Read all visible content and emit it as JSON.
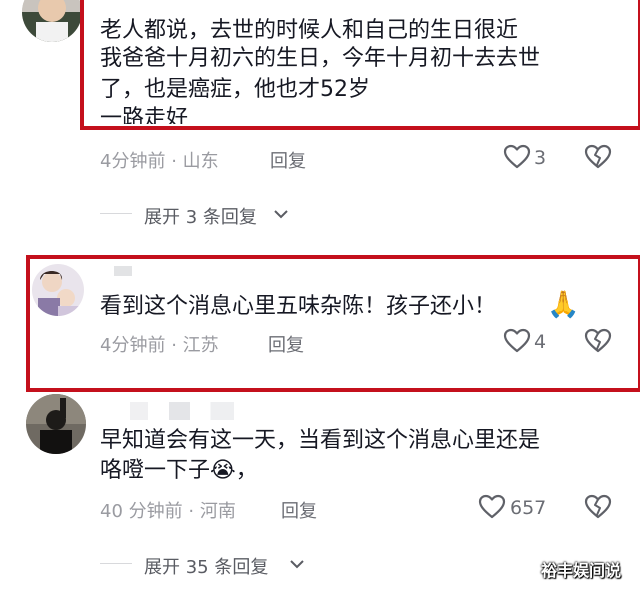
{
  "comments": [
    {
      "lines": [
        "老人都说，去世的时候人和自己的生日很近",
        "  我爸爸十月初六的生日，今年十月初十去去世",
        "了，也是癌症，他也才52岁",
        "一路走好"
      ],
      "time": "4分钟前",
      "location": "山东",
      "reply_label": "回复",
      "likes": "3",
      "expand_label": "展开 3 条回复"
    },
    {
      "lines": [
        "看到这个消息心里五味杂陈！孩子还小！"
      ],
      "emoji": "🙏",
      "time": "4分钟前",
      "location": "江苏",
      "reply_label": "回复",
      "likes": "4"
    },
    {
      "lines": [
        "早知道会有这一天，当看到这个消息心里还是",
        "咯噔一下子"
      ],
      "emoji": "😭",
      "time": "40 分钟前",
      "location": "河南",
      "reply_label": "回复",
      "likes": "657",
      "expand_label": "展开 35 条回复"
    }
  ],
  "meta_separator": "·",
  "watermark": "裕丰娱间说",
  "colors": {
    "highlight_border": "#c4101c",
    "text": "#161823",
    "meta": "#9a9ba1"
  },
  "icons": [
    "heart-outline-icon",
    "broken-heart-icon",
    "chevron-down-icon"
  ]
}
